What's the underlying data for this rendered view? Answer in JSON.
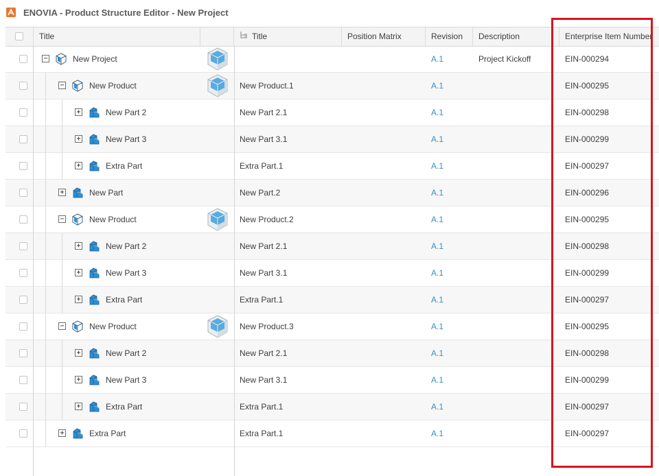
{
  "app": {
    "title": "ENOVIA - Product Structure Editor - New Project"
  },
  "columns": {
    "title": "Title",
    "instance_title": "Title",
    "position_matrix": "Position Matrix",
    "revision": "Revision",
    "description": "Description",
    "enterprise_item_number": "Enterprise Item Number"
  },
  "rows": [
    {
      "title": "New Project",
      "instance": "",
      "revision": "A.1",
      "description": "Project Kickoff",
      "ein": "EIN-000294",
      "type": "product",
      "level": 0,
      "expander": "-",
      "thumbnail": true
    },
    {
      "title": "New Product",
      "instance": "New Product.1",
      "revision": "A.1",
      "description": "",
      "ein": "EIN-000295",
      "type": "product",
      "level": 1,
      "expander": "-",
      "thumbnail": true
    },
    {
      "title": "New Part 2",
      "instance": "New Part 2.1",
      "revision": "A.1",
      "description": "",
      "ein": "EIN-000298",
      "type": "part",
      "level": 2,
      "expander": "+",
      "thumbnail": false
    },
    {
      "title": "New Part 3",
      "instance": "New Part 3.1",
      "revision": "A.1",
      "description": "",
      "ein": "EIN-000299",
      "type": "part",
      "level": 2,
      "expander": "+",
      "thumbnail": false
    },
    {
      "title": "Extra Part",
      "instance": "Extra Part.1",
      "revision": "A.1",
      "description": "",
      "ein": "EIN-000297",
      "type": "part",
      "level": 2,
      "expander": "+",
      "thumbnail": false
    },
    {
      "title": "New Part",
      "instance": "New Part.2",
      "revision": "A.1",
      "description": "",
      "ein": "EIN-000296",
      "type": "part",
      "level": 1,
      "expander": "+",
      "thumbnail": false
    },
    {
      "title": "New Product",
      "instance": "New Product.2",
      "revision": "A.1",
      "description": "",
      "ein": "EIN-000295",
      "type": "product",
      "level": 1,
      "expander": "-",
      "thumbnail": true
    },
    {
      "title": "New Part 2",
      "instance": "New Part 2.1",
      "revision": "A.1",
      "description": "",
      "ein": "EIN-000298",
      "type": "part",
      "level": 2,
      "expander": "+",
      "thumbnail": false
    },
    {
      "title": "New Part 3",
      "instance": "New Part 3.1",
      "revision": "A.1",
      "description": "",
      "ein": "EIN-000299",
      "type": "part",
      "level": 2,
      "expander": "+",
      "thumbnail": false
    },
    {
      "title": "Extra Part",
      "instance": "Extra Part.1",
      "revision": "A.1",
      "description": "",
      "ein": "EIN-000297",
      "type": "part",
      "level": 2,
      "expander": "+",
      "thumbnail": false
    },
    {
      "title": "New Product",
      "instance": "New Product.3",
      "revision": "A.1",
      "description": "",
      "ein": "EIN-000295",
      "type": "product",
      "level": 1,
      "expander": "-",
      "thumbnail": true
    },
    {
      "title": "New Part 2",
      "instance": "New Part 2.1",
      "revision": "A.1",
      "description": "",
      "ein": "EIN-000298",
      "type": "part",
      "level": 2,
      "expander": "+",
      "thumbnail": false
    },
    {
      "title": "New Part 3",
      "instance": "New Part 3.1",
      "revision": "A.1",
      "description": "",
      "ein": "EIN-000299",
      "type": "part",
      "level": 2,
      "expander": "+",
      "thumbnail": false
    },
    {
      "title": "Extra Part",
      "instance": "Extra Part.1",
      "revision": "A.1",
      "description": "",
      "ein": "EIN-000297",
      "type": "part",
      "level": 2,
      "expander": "+",
      "thumbnail": false
    },
    {
      "title": "Extra Part",
      "instance": "Extra Part.1",
      "revision": "A.1",
      "description": "",
      "ein": "EIN-000297",
      "type": "part",
      "level": 1,
      "expander": "+",
      "thumbnail": false
    }
  ],
  "colors": {
    "link": "#368ec4",
    "highlight": "#d8141c",
    "icon": "#2f8ed3",
    "app_logo": "#e8772e"
  }
}
